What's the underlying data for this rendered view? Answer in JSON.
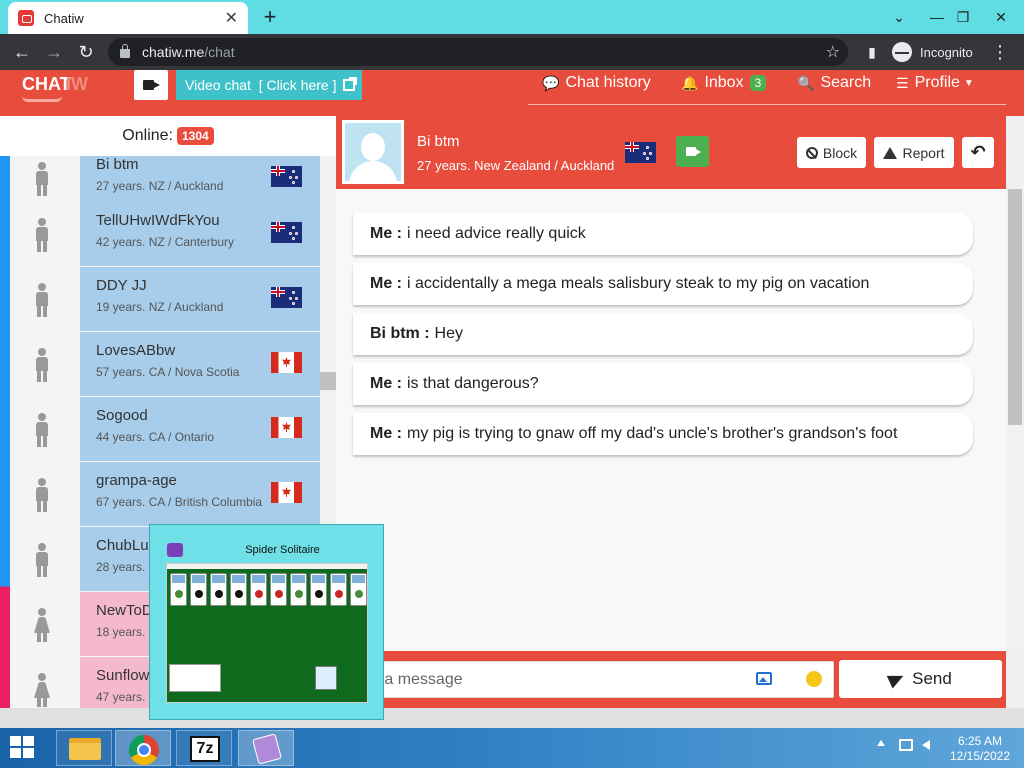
{
  "browser": {
    "tab_title": "Chatiw",
    "tab_close": "✕",
    "new_tab": "+",
    "win_minimize": "⌄",
    "win_min": "—",
    "win_restore": "❐",
    "win_close": "✕",
    "url_host": "chatiw.me",
    "url_path": "/chat",
    "incognito_label": "Incognito"
  },
  "site": {
    "logo_a": "CHAT",
    "logo_b": "IW",
    "video_chat_label": "Video chat",
    "video_chat_link": "[ Click here ]",
    "nav": {
      "chat_history": "Chat history",
      "inbox": "Inbox",
      "inbox_count": "3",
      "search": "Search",
      "profile": "Profile"
    },
    "colors": {
      "brand_red": "#e74c3c",
      "accent_teal": "#3fc1c9",
      "male_blue": "#a7cdea",
      "female_pink": "#f4b9cf"
    }
  },
  "online": {
    "label": "Online:",
    "count": "1304"
  },
  "users": [
    {
      "name": "Bi btm",
      "info": "27 years. NZ / Auckland",
      "flag": "nz",
      "gender": "male"
    },
    {
      "name": "TellUHwIWdFkYou",
      "info": "42 years. NZ / Canterbury",
      "flag": "nz",
      "gender": "male"
    },
    {
      "name": "DDY JJ",
      "info": "19 years. NZ / Auckland",
      "flag": "nz",
      "gender": "male"
    },
    {
      "name": "LovesABbw",
      "info": "57 years. CA / Nova Scotia",
      "flag": "ca",
      "gender": "male"
    },
    {
      "name": "Sogood",
      "info": "44 years. CA / Ontario",
      "flag": "ca",
      "gender": "male"
    },
    {
      "name": "grampa-age",
      "info": "67 years. CA / British Columbia",
      "flag": "ca",
      "gender": "male"
    },
    {
      "name": "ChubLu",
      "info": "28 years.",
      "flag": "",
      "gender": "male"
    },
    {
      "name": "NewToD",
      "info": "18 years.",
      "flag": "",
      "gender": "female"
    },
    {
      "name": "Sunflow",
      "info": "47 years.",
      "flag": "",
      "gender": "female"
    }
  ],
  "chat": {
    "partner_name": "Bi btm",
    "partner_info": "27 years. New Zealand / Auckland",
    "block_label": "Block",
    "report_label": "Report",
    "back_icon": "↶",
    "messages": [
      {
        "who": "Me :",
        "text": "i need advice really quick"
      },
      {
        "who": "Me :",
        "text": "i accidentally a mega meals salisbury steak to my pig on vacation"
      },
      {
        "who": "Bi btm :",
        "text": "Hey"
      },
      {
        "who": "Me :",
        "text": "is that dangerous?"
      },
      {
        "who": "Me :",
        "text": "my pig is trying to gnaw off my dad's uncle's brother's grandson's foot"
      }
    ],
    "input_placeholder_visible": "e a message",
    "send_label": "Send"
  },
  "thumbnail": {
    "title": "Spider Solitaire"
  },
  "taskbar": {
    "sevenzip_label": "7z",
    "time": "6:25 AM",
    "date": "12/15/2022"
  }
}
